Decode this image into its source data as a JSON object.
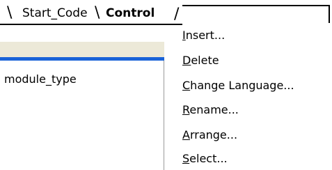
{
  "tabs": {
    "start_code": "Start_Code",
    "control": "Control"
  },
  "left_pane": {
    "row_label": "module_type"
  },
  "context_menu": {
    "items": [
      {
        "underline": "I",
        "rest": "nsert..."
      },
      {
        "underline": "D",
        "rest": "elete"
      },
      {
        "underline": "C",
        "rest": "hange Language..."
      },
      {
        "underline": "R",
        "rest": "ename..."
      },
      {
        "underline": "A",
        "rest": "rrange..."
      },
      {
        "underline": "S",
        "rest": "elect..."
      }
    ]
  },
  "colors": {
    "pane_header": "#ece9d8",
    "selection_bar": "#1a63d8"
  }
}
